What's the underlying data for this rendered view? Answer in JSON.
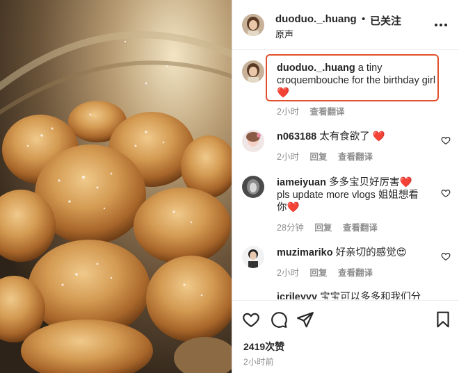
{
  "post": {
    "username": "duoduo._.huang",
    "follow_dot": "•",
    "follow_status": "已关注",
    "audio_label": "原声",
    "more_icon": "more-horizontal-icon"
  },
  "comments": [
    {
      "username": "duoduo._.huang",
      "text": "a tiny croquembouche for the birthday girl",
      "emoji": "❤️",
      "time": "2小时",
      "reply": "",
      "translate": "查看翻译",
      "highlighted": true
    },
    {
      "username": "n063188",
      "text": "太有食欲了",
      "emoji": "❤️",
      "time": "2小时",
      "reply": "回复",
      "translate": "查看翻译"
    },
    {
      "username": "iameiyuan",
      "text_line1": "多多宝贝好厉害",
      "text_line2": "pls update more vlogs 姐姐想看",
      "text_line3": "你",
      "emoji": "❤️",
      "time": "28分钟",
      "reply": "回复",
      "translate": "查看翻译"
    },
    {
      "username": "muzimariko",
      "text": "好亲切的感觉",
      "emoji": "😍",
      "time": "2小时",
      "reply": "回复",
      "translate": "查看翻译"
    },
    {
      "username": "jcrileyyy",
      "text": "宝宝可以多多和我们分"
    }
  ],
  "footer": {
    "likes": "2419次赞",
    "posted": "2小时前"
  },
  "colors": {
    "highlight": "#e0502b",
    "heart_red": "#ed4956",
    "meta_gray": "#8e8e8e"
  }
}
